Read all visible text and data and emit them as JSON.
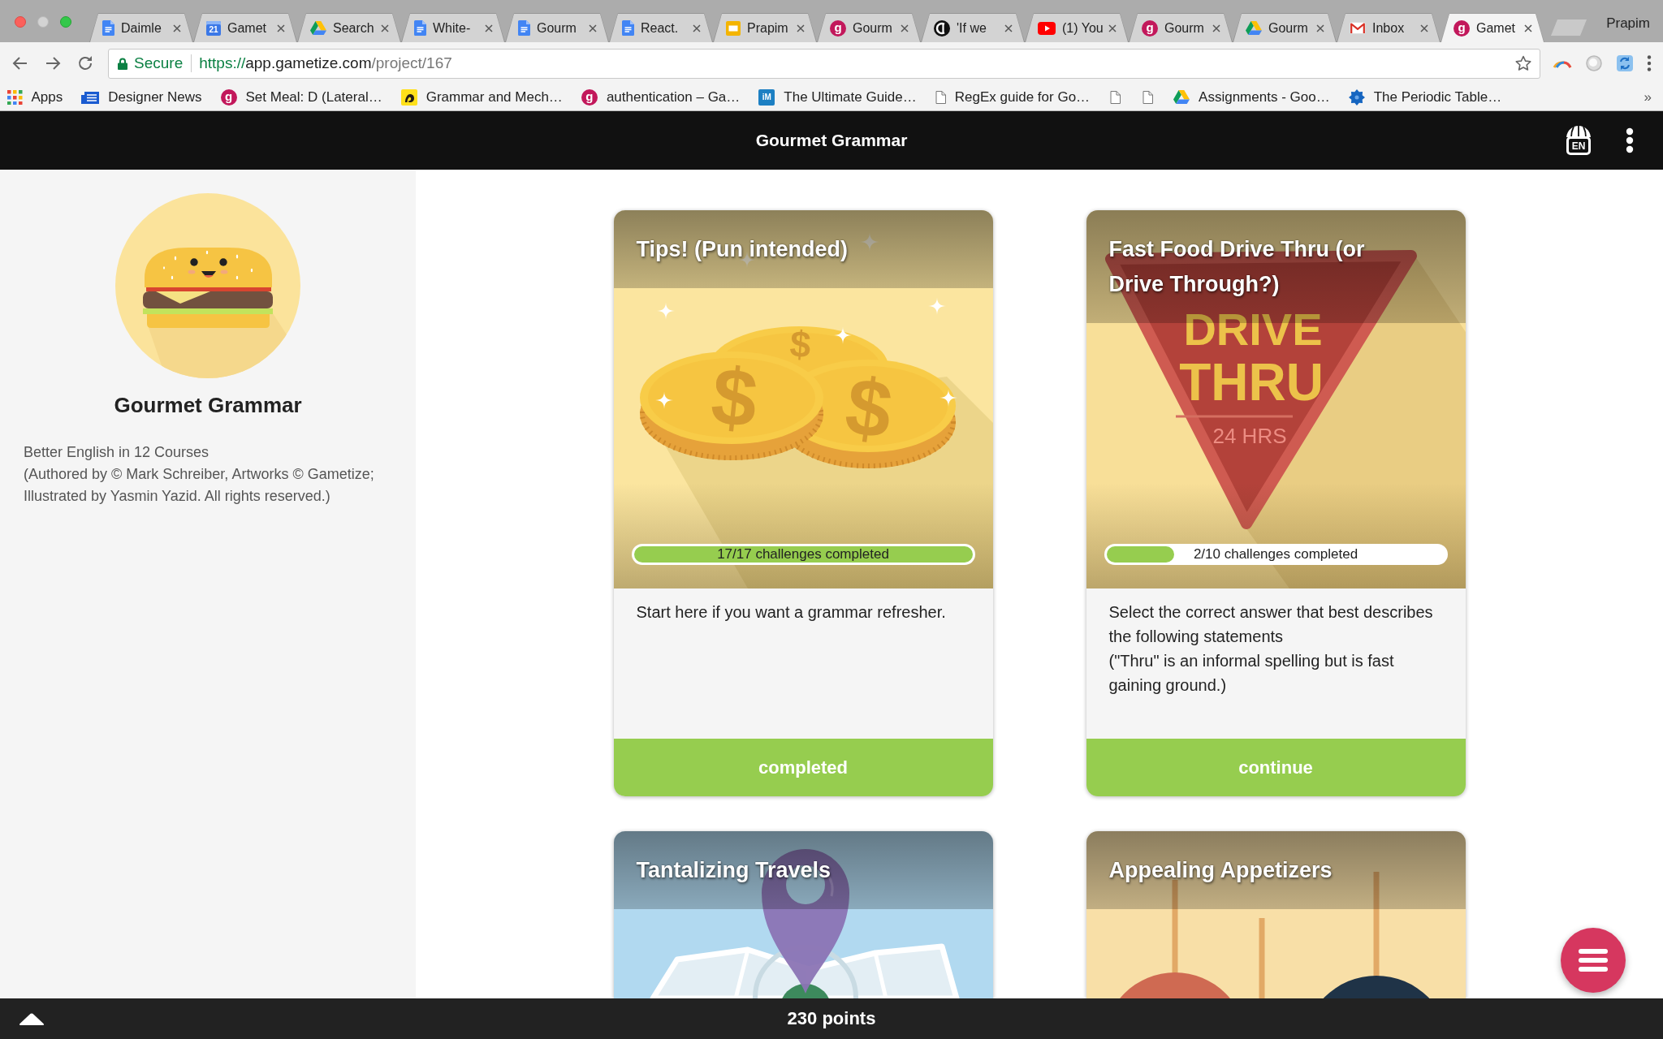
{
  "browser": {
    "tabs": [
      {
        "kind": "docs",
        "title": "Daimle",
        "selected": false
      },
      {
        "kind": "calendar",
        "glyph": "21",
        "title": "Gamet",
        "selected": false
      },
      {
        "kind": "drive",
        "title": "Search",
        "selected": false
      },
      {
        "kind": "docs",
        "title": "White-",
        "selected": false
      },
      {
        "kind": "docs",
        "title": "Gourm",
        "selected": false
      },
      {
        "kind": "docs",
        "title": "React.",
        "selected": false
      },
      {
        "kind": "slides",
        "title": "Prapim",
        "selected": false
      },
      {
        "kind": "gametize",
        "glyph": "g",
        "title": "Gourm",
        "selected": false
      },
      {
        "kind": "ring",
        "title": "'If we",
        "selected": false
      },
      {
        "kind": "video",
        "title": "(1) You",
        "selected": false
      },
      {
        "kind": "gametize",
        "glyph": "g",
        "title": "Gourm",
        "selected": false
      },
      {
        "kind": "drive",
        "title": "Gourm",
        "selected": false
      },
      {
        "kind": "mail",
        "title": "Inbox",
        "selected": false
      },
      {
        "kind": "gametize",
        "glyph": "g",
        "title": "Gamet",
        "selected": true
      }
    ],
    "profile": "Prapim",
    "address": {
      "secure_label": "Secure",
      "scheme": "https://",
      "host": "app.gametize.com",
      "path": "/project/167"
    },
    "bookmarks": [
      {
        "kind": "apps",
        "label": "Apps"
      },
      {
        "kind": "news",
        "label": "Designer News"
      },
      {
        "kind": "gametize",
        "glyph": "g",
        "label": "Set Meal: D (Lateral…"
      },
      {
        "kind": "chimp",
        "label": "Grammar and Mech…"
      },
      {
        "kind": "gametize",
        "glyph": "g",
        "label": "authentication – Ga…"
      },
      {
        "kind": "tile",
        "glyph": "iM",
        "label": "The Ultimate Guide…"
      },
      {
        "kind": "page",
        "label": "RegEx guide for Go…"
      },
      {
        "kind": "page"
      },
      {
        "kind": "page"
      },
      {
        "kind": "drive",
        "label": "Assignments - Goo…"
      },
      {
        "kind": "gear",
        "label": "The Periodic Table…"
      }
    ],
    "bookmarks_overflow": "»"
  },
  "app_header": {
    "title": "Gourmet Grammar",
    "language": "EN"
  },
  "sidebar": {
    "title": "Gourmet Grammar",
    "description": [
      "Better English in 12 Courses",
      "(Authored by © Mark Schreiber, Artworks © Gametize; Illustrated by Yasmin Yazid. All rights reserved.)"
    ]
  },
  "topics": [
    {
      "title": "Tips! (Pun intended)",
      "artwork": {
        "kind": "coins",
        "texts": [
          "$",
          "$",
          "$"
        ]
      },
      "progress": {
        "label": "17/17 challenges completed",
        "level": 1
      },
      "description": [
        "Start here if you want a grammar refresher."
      ],
      "action": "completed"
    },
    {
      "title": "Fast Food Drive Thru (or Drive Through?)",
      "artwork": {
        "kind": "drive_thru",
        "texts": [
          "DRIVE",
          "THRU",
          "24 HRS"
        ]
      },
      "progress": {
        "label": "2/10 challenges completed",
        "level": 0.2
      },
      "description": [
        "Select the correct answer that best describes the following statements",
        "(\"Thru\" is an informal spelling but is fast gaining ground.)"
      ],
      "action": "continue"
    },
    {
      "title": "Tantalizing Travels",
      "artwork": {
        "kind": "map"
      }
    },
    {
      "title": "Appealing Appetizers",
      "artwork": {
        "kind": "appetizers"
      }
    }
  ],
  "points": "230 points"
}
